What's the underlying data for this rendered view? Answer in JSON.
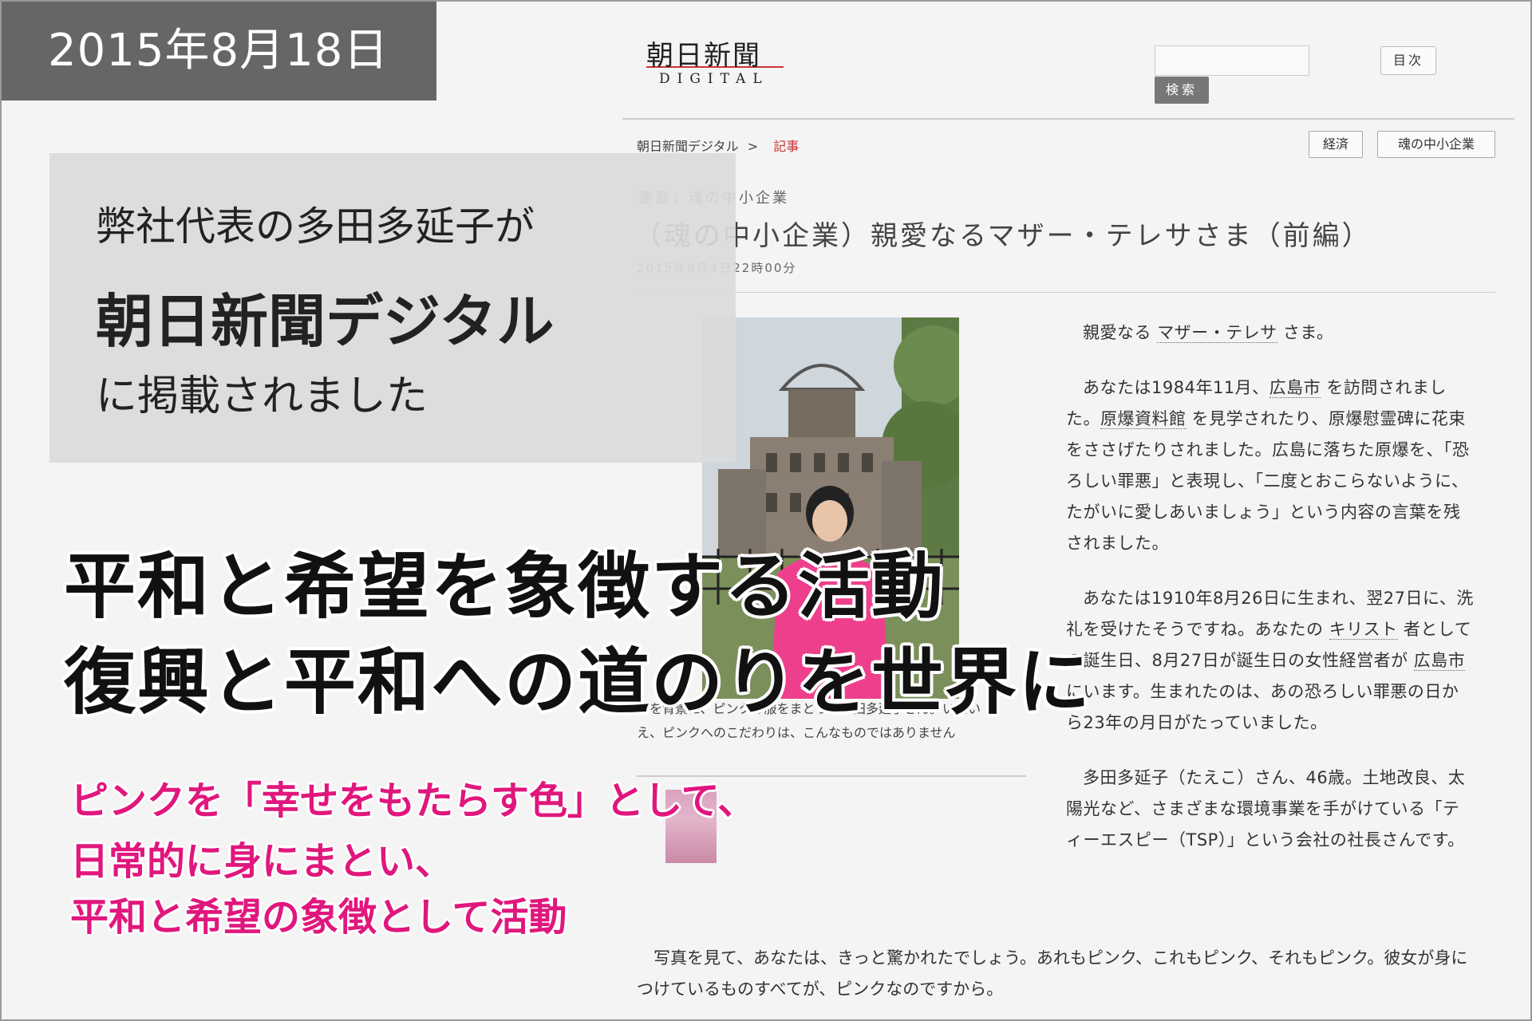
{
  "date_banner": "2015年8月18日",
  "intro": {
    "line1": "弊社代表の多田多延子が",
    "line2": "朝日新聞デジタル",
    "line3": "に掲載されました"
  },
  "headline": {
    "line1": "平和と希望を象徴する活動",
    "line2": "復興と平和への道のりを世界に"
  },
  "pink_text": {
    "line1": "ピンクを「幸せをもたらす色」として、",
    "line2": "日常的に身にまとい、",
    "line3": "平和と希望の象徴として活動"
  },
  "site": {
    "logo_main": "朝日新聞",
    "logo_sub": "DIGITAL",
    "search_button": "検索",
    "toc_button": "目次"
  },
  "breadcrumb": {
    "home": "朝日新聞デジタル",
    "separator": ">",
    "current": "記事"
  },
  "tags": [
    "経済",
    "魂の中小企業"
  ],
  "article": {
    "series": "連載：魂の中小企業",
    "title": "（魂の中小企業）親愛なるマザー・テレサさま（前編）",
    "date": "2015年8月4日22時00分",
    "caption": "…を背景に、ピンクの服をまとった多田多延子さん。いえいえ、ピンクへのこだわりは、こんなものではありません",
    "p1": {
      "a": "親愛なる ",
      "link1": "マザー・テレサ",
      "b": " さま。"
    },
    "p2": {
      "a": "あなたは1984年11月、",
      "link1": "広島市",
      "b": " を訪問されました。",
      "link2": "原爆資料館",
      "c": " を見学されたり、原爆慰霊碑に花束をささげたりされました。広島に落ちた原爆を、「恐ろしい罪悪」と表現し、「二度とおこらないように、たがいに愛しあいましょう」という内容の言葉を残されました。"
    },
    "p3": {
      "a": "あなたは1910年8月26日に生まれ、翌27日に、洗礼を受けたそうですね。あなたの ",
      "link1": "キリスト",
      "b": " 者としての誕生日、8月27日が誕生日の女性経営者が ",
      "link2": "広島市",
      "c": " にいます。生まれたのは、あの恐ろしい罪悪の日から23年の月日がたっていました。"
    },
    "p4": "多田多延子（たえこ）さん、46歳。土地改良、太陽光など、さまざまな環境事業を手がけている「ティーエスピー（TSP）」という会社の社長さんです。",
    "p5": "写真を見て、あなたは、きっと驚かれたでしょう。あれもピンク、これもピンク、それもピンク。彼女が身につけているものすべてが、ピンクなのですから。"
  },
  "colors": {
    "accent_pink": "#e0177d",
    "banner_gray": "#666666",
    "breadcrumb_red": "#cc3333"
  }
}
